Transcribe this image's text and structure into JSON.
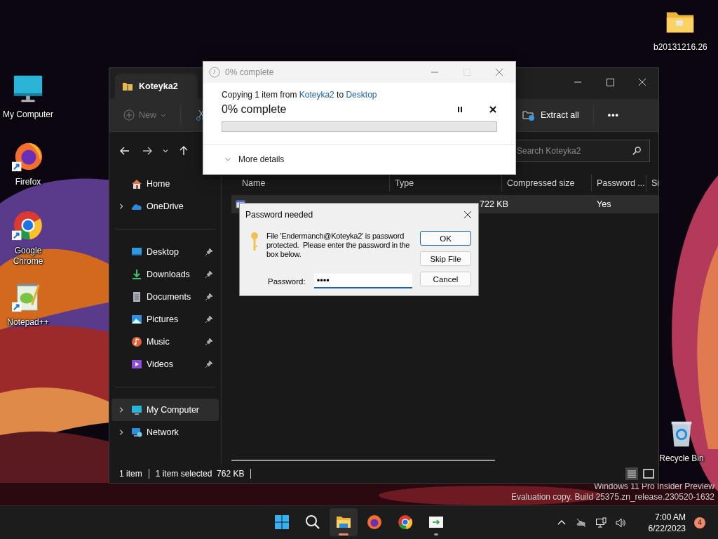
{
  "desktop_icons": [
    {
      "label": "My Computer",
      "kind": "monitor",
      "shortcut": false
    },
    {
      "label": "Firefox",
      "kind": "firefox",
      "shortcut": true
    },
    {
      "label": "Google Chrome",
      "kind": "chrome",
      "shortcut": true
    },
    {
      "label": "Notepad++",
      "kind": "notepad",
      "shortcut": true
    },
    {
      "label": "b20131216.26",
      "kind": "folder",
      "shortcut": false
    },
    {
      "label": "Recycle Bin",
      "kind": "recycle",
      "shortcut": false
    }
  ],
  "explorer": {
    "tab_title": "Koteyka2",
    "toolbar": {
      "new": {
        "label": "New",
        "disabled": true
      },
      "extract": "Extract all",
      "more": "•••"
    },
    "search": {
      "placeholder": "Search Koteyka2"
    },
    "sidebar": {
      "groups": [
        {
          "items": [
            {
              "label": "Home",
              "kind": "home",
              "selected": false
            },
            {
              "label": "OneDrive",
              "kind": "onedrive",
              "selected": false,
              "expanded": false
            }
          ]
        },
        {
          "items": [
            {
              "label": "Desktop",
              "kind": "desktop",
              "selected": false,
              "pinned": true
            },
            {
              "label": "Downloads",
              "kind": "downloads",
              "selected": false,
              "pinned": true
            },
            {
              "label": "Documents",
              "kind": "documents",
              "selected": false,
              "pinned": true
            },
            {
              "label": "Pictures",
              "kind": "pictures",
              "selected": false,
              "pinned": true
            },
            {
              "label": "Music",
              "kind": "music",
              "selected": false,
              "pinned": true
            },
            {
              "label": "Videos",
              "kind": "videos",
              "selected": false,
              "pinned": true
            }
          ]
        },
        {
          "items": [
            {
              "label": "My Computer",
              "kind": "computer",
              "selected": true,
              "expanded": false
            },
            {
              "label": "Network",
              "kind": "network",
              "selected": false,
              "expanded": false
            }
          ]
        }
      ]
    },
    "columns": [
      "Name",
      "Type",
      "Compressed size",
      "Password ...",
      "Si"
    ],
    "rows": [
      {
        "compressed_size": "722 KB",
        "password": "Yes",
        "selected": true
      }
    ],
    "status": {
      "count": "1 item",
      "selection": "1 item selected  762 KB"
    }
  },
  "copy_dialog": {
    "title": "0% complete",
    "message": {
      "prefix": "Copying 1 item from",
      "source": "Koteyka2",
      "middle": "to",
      "destination": "Desktop"
    },
    "status": "0% complete",
    "level": 0,
    "details": "More details",
    "details_expanded": false
  },
  "password_dialog": {
    "title": "Password needed",
    "message": "File 'Endermanch@Koteyka2' is password protected.  Please enter the password in the box below.",
    "label": "Password:",
    "value": "••••",
    "buttons": [
      {
        "label": "OK",
        "default": true
      },
      {
        "label": "Skip File",
        "default": false
      },
      {
        "label": "Cancel",
        "default": false
      }
    ]
  },
  "watermark": [
    "Windows 11 Pro Insider Preview",
    "Evaluation copy. Build 25375.zn_release.230520-1632"
  ],
  "taskbar": {
    "apps": [
      {
        "kind": "start",
        "active": false,
        "running": false
      },
      {
        "kind": "search",
        "active": false,
        "running": false
      },
      {
        "kind": "explorer",
        "active": true,
        "running": true
      },
      {
        "kind": "firefox",
        "active": false,
        "running": false
      },
      {
        "kind": "chrome",
        "active": false,
        "running": false
      },
      {
        "kind": "app",
        "active": false,
        "running": true
      }
    ],
    "time": "7:00 AM",
    "date": "6/22/2023",
    "notifications": "4"
  }
}
